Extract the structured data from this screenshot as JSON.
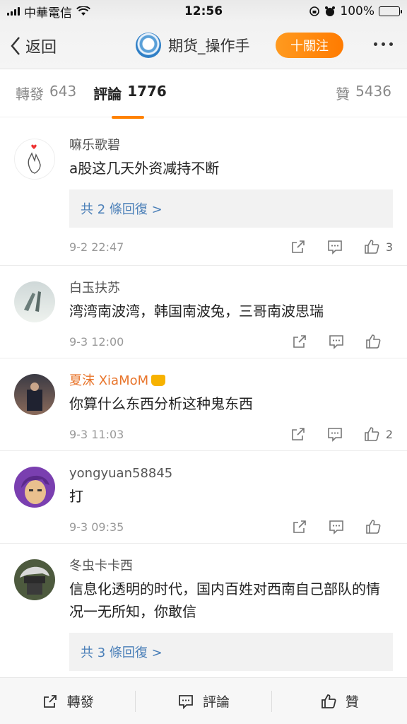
{
  "status": {
    "carrier": "中華電信",
    "time": "12:56",
    "battery": "100%"
  },
  "nav": {
    "back_label": "返回",
    "title": "期货_操作手",
    "follow_label": "十關注"
  },
  "tabs": {
    "repost_label": "轉發",
    "repost_count": "643",
    "comment_label": "評論",
    "comment_count": "1776",
    "like_label": "贊",
    "like_count": "5436"
  },
  "comments": [
    {
      "name": "嘛乐歌碧",
      "text": "a股这几天外资减持不断",
      "replies": "共 2 條回復 >",
      "date": "9-2 22:47",
      "likes": "3"
    },
    {
      "name": "白玉扶苏",
      "text": "湾湾南波湾，韩国南波兔，三哥南波思瑞",
      "date": "9-3 12:00",
      "likes": ""
    },
    {
      "name": "夏沫 XiaMoM",
      "text": "你算什么东西分析这种鬼东西",
      "date": "9-3 11:03",
      "likes": "2"
    },
    {
      "name": "yongyuan58845",
      "text": "打",
      "date": "9-3 09:35",
      "likes": ""
    },
    {
      "name": "冬虫卡卡西",
      "text": "信息化透明的时代，国内百姓对西南自己部队的情况一无所知，你敢信",
      "replies": "共 3 條回復 >"
    }
  ],
  "bottom": {
    "repost": "轉發",
    "comment": "評論",
    "like": "贊"
  }
}
